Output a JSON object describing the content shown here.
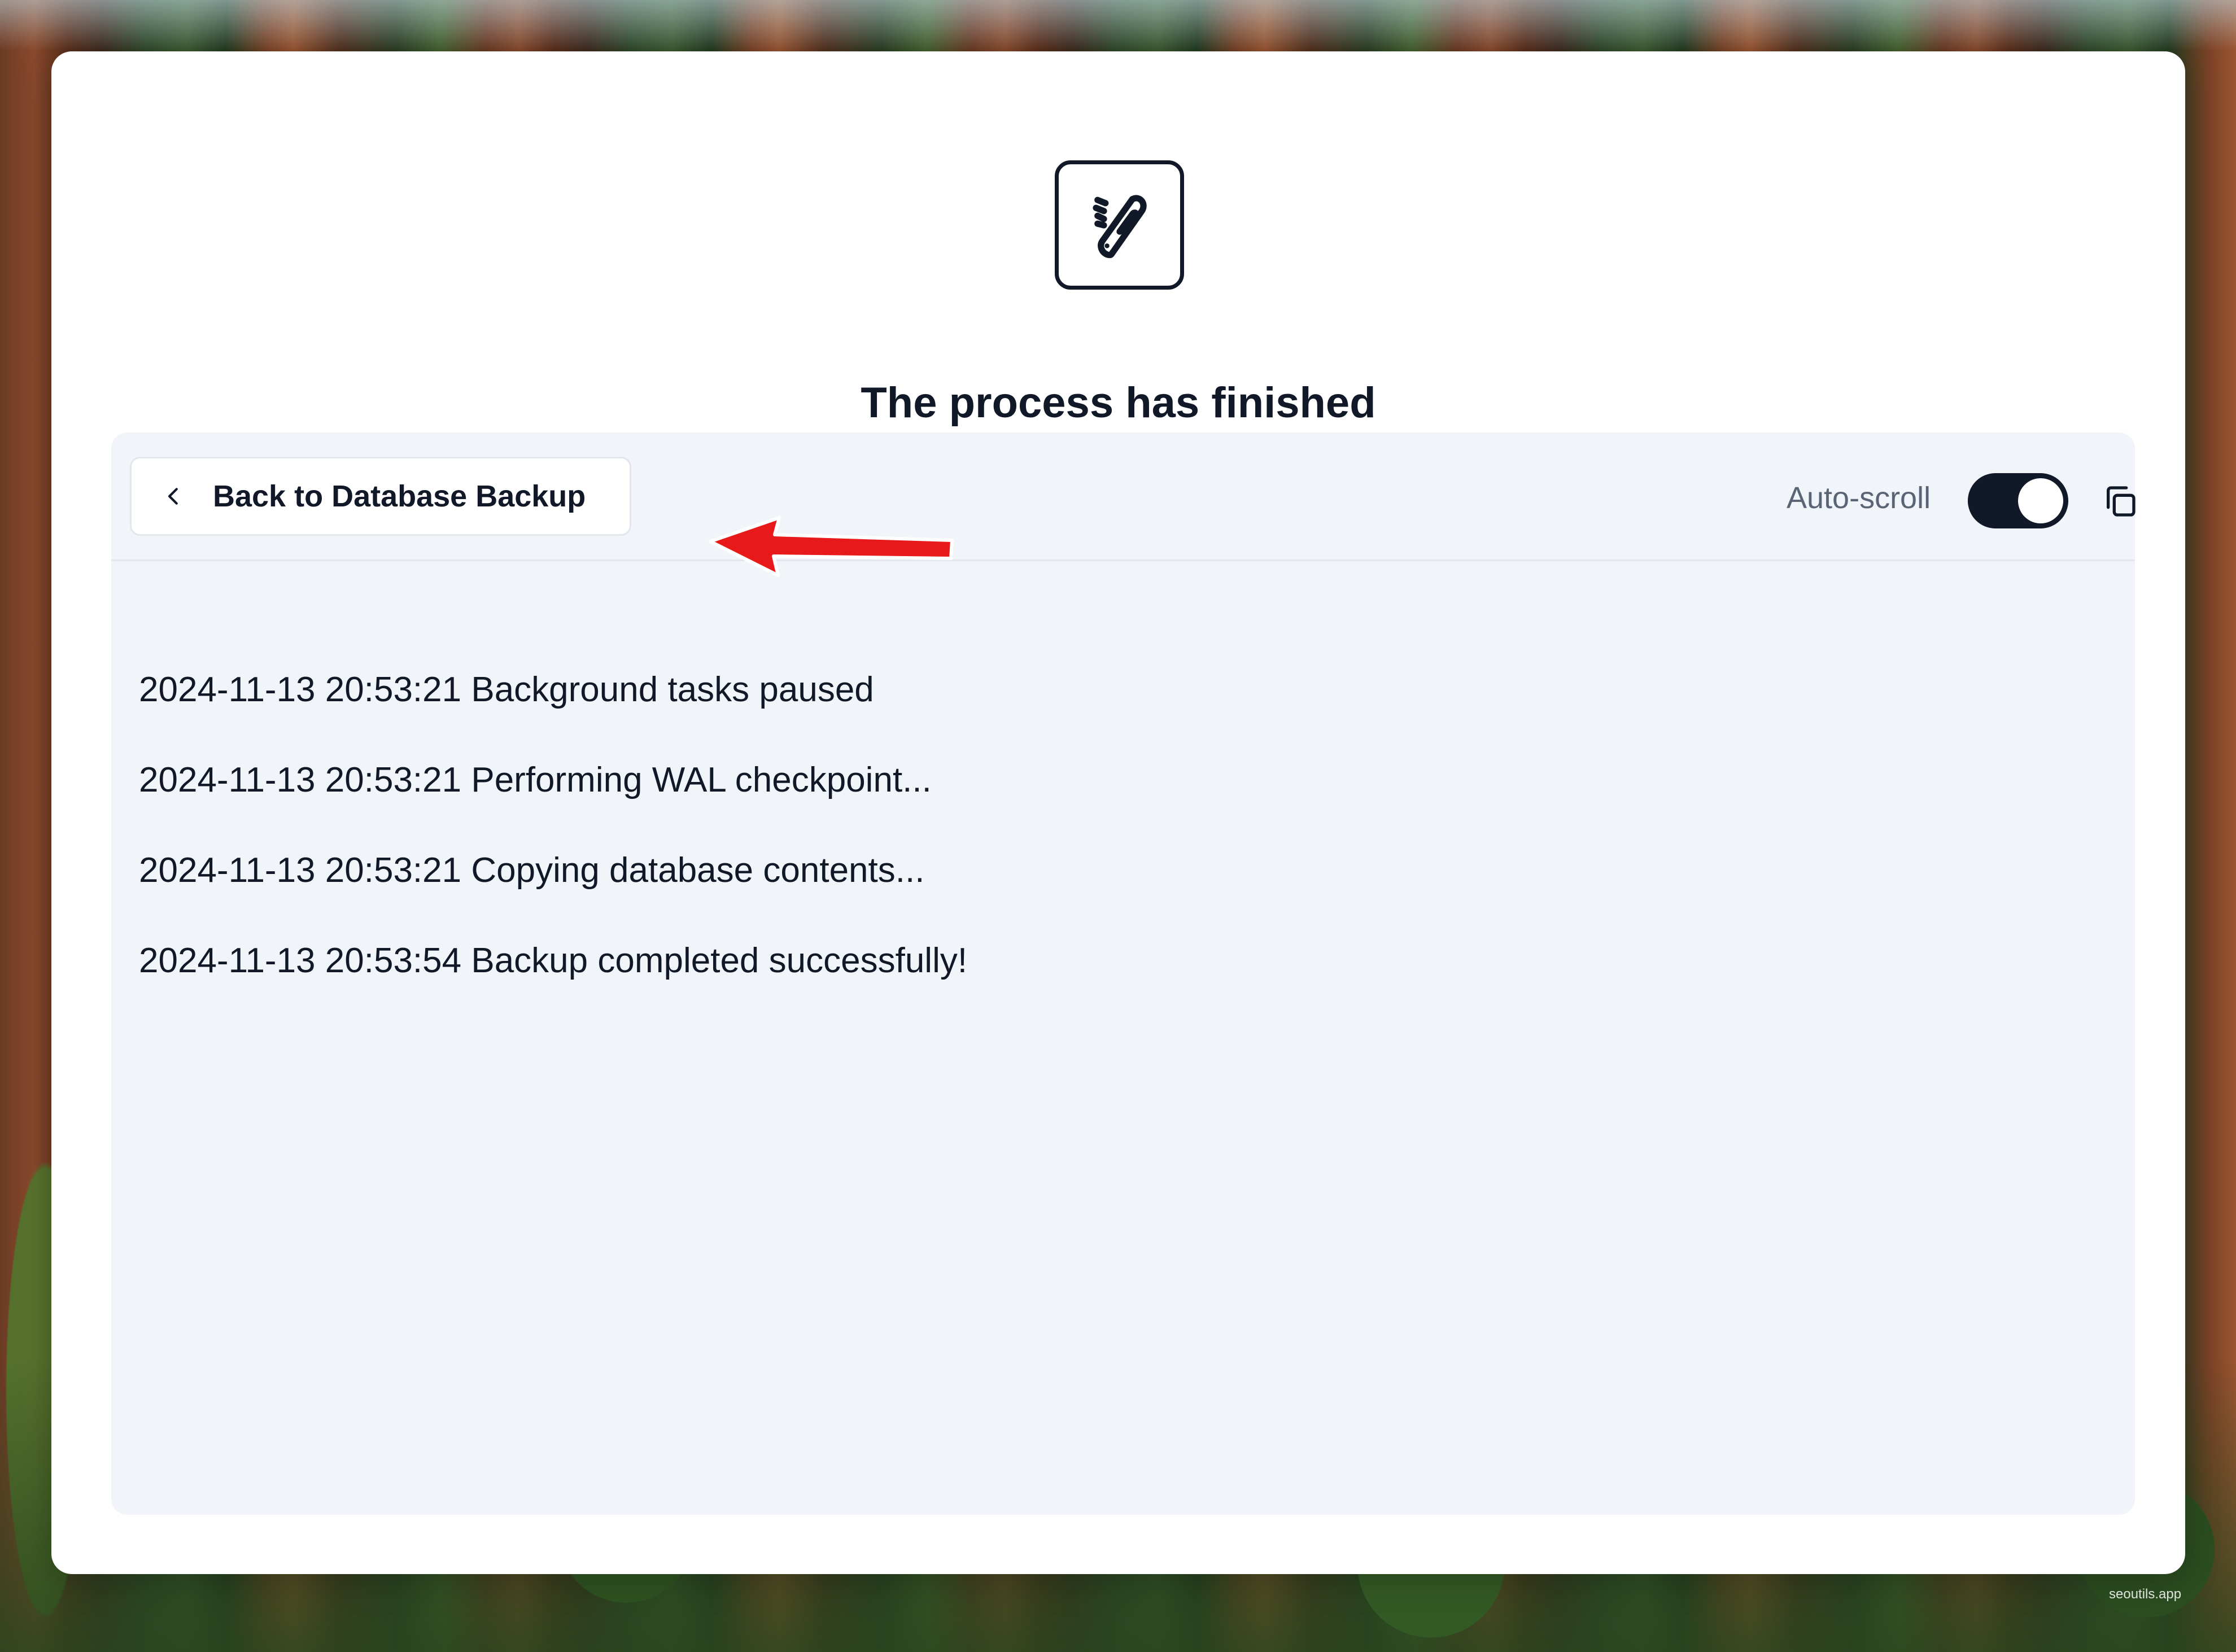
{
  "header": {
    "logo_icon": "swiss-army-knife-icon",
    "title": "The process has finished"
  },
  "toolbar": {
    "back_button_label": "Back to Database Backup",
    "back_icon": "chevron-left-icon",
    "autoscroll_label": "Auto-scroll",
    "autoscroll_enabled": true,
    "copy_icon": "copy-icon"
  },
  "log": {
    "lines": [
      "2024-11-13 20:53:21 Background tasks paused",
      "2024-11-13 20:53:21 Performing WAL checkpoint...",
      "2024-11-13 20:53:21 Copying database contents...",
      "2024-11-13 20:53:54 Backup completed successfully!"
    ]
  },
  "annotation": {
    "arrow_color": "#e8191a",
    "arrow_icon": "red-arrow-pointer"
  },
  "watermark": "seoutils.app",
  "colors": {
    "text_primary": "#111827",
    "panel_bg": "#f1f4f8",
    "toggle_on": "#111827"
  }
}
